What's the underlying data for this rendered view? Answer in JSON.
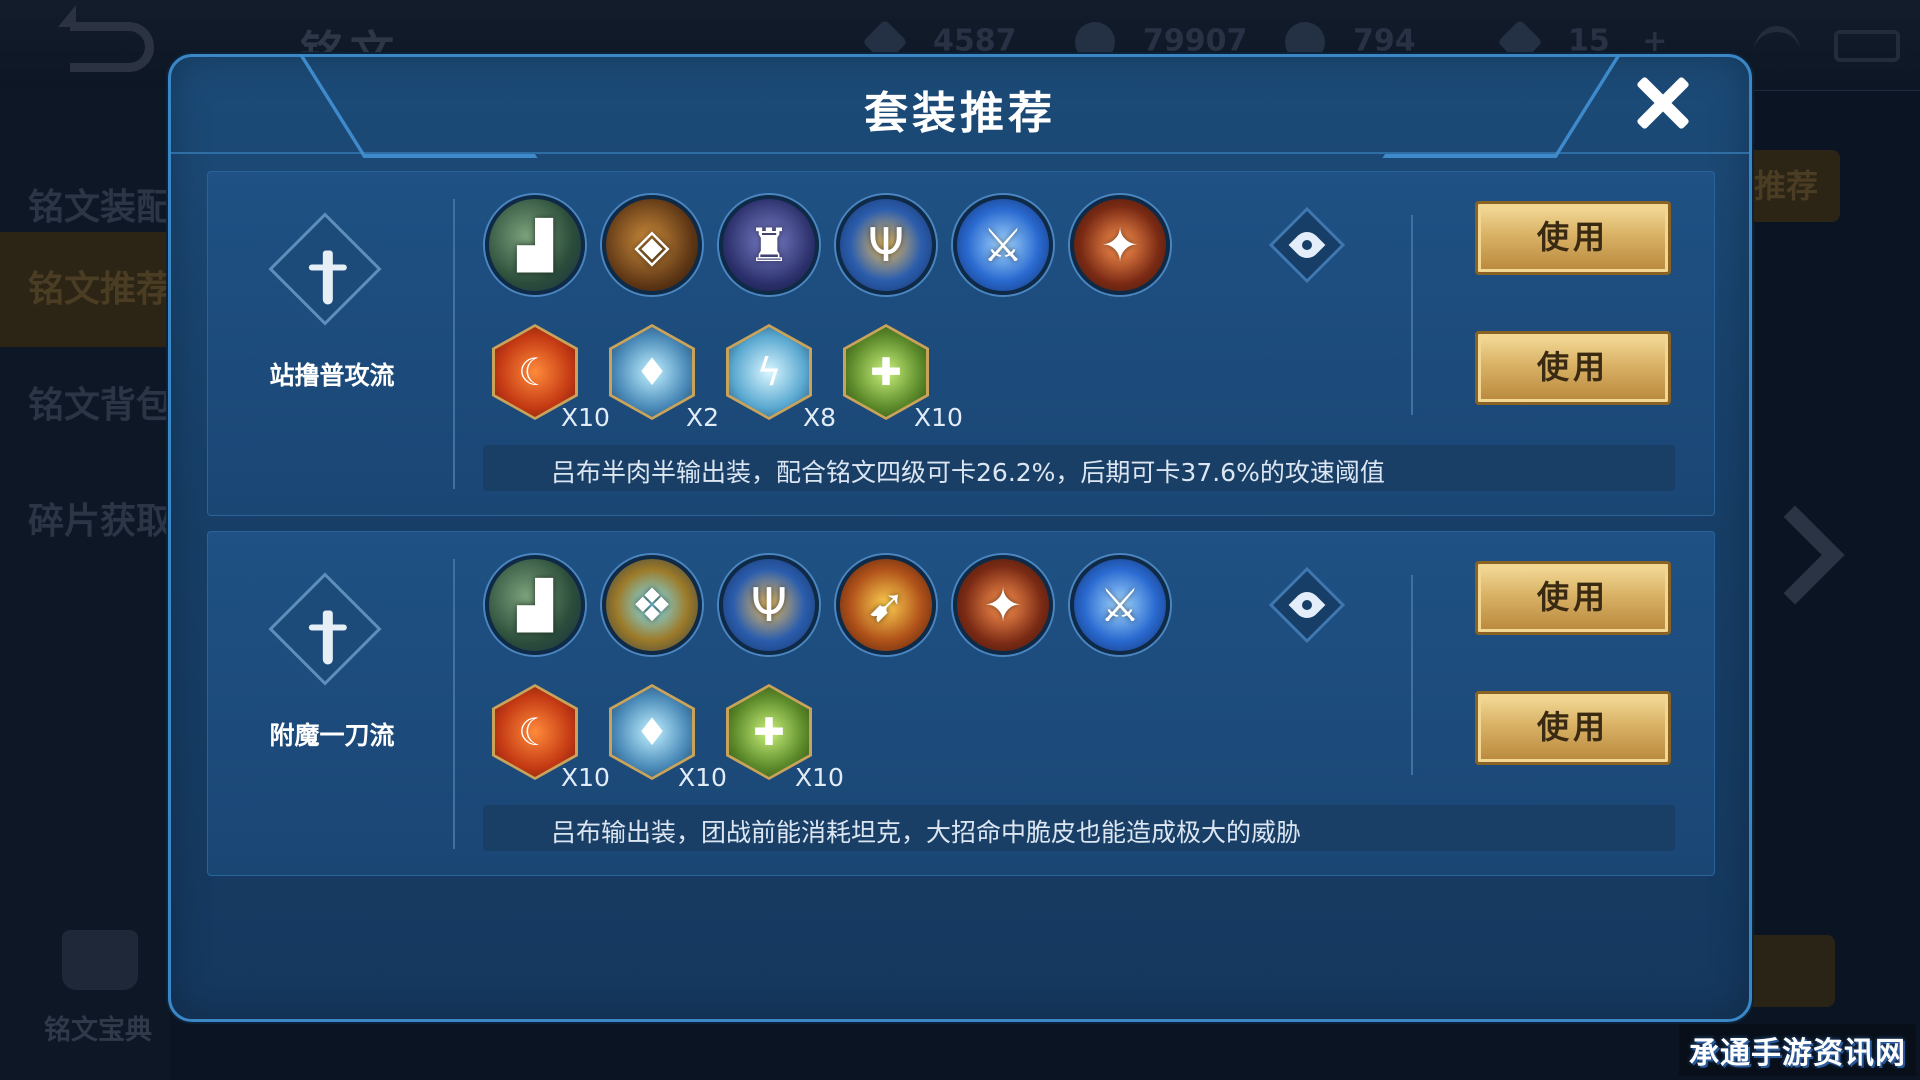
{
  "background": {
    "title": "铭文",
    "resources": [
      "4587",
      "79907",
      "794",
      "15"
    ],
    "plus_symbol": "+",
    "sidebar_items": [
      "铭文装配",
      "铭文推荐",
      "铭文背包",
      "碎片获取"
    ],
    "codex_label": "铭文宝典",
    "right_button_label": "推荐"
  },
  "modal": {
    "title": "套装推荐",
    "close_icon": "close-icon",
    "sets": [
      {
        "name": "站撸普攻流",
        "equipment": [
          "boots",
          "armor",
          "cloak",
          "trident",
          "blade",
          "axe"
        ],
        "runes": [
          {
            "type": "red",
            "count": "X10"
          },
          {
            "type": "blue",
            "count": "X2"
          },
          {
            "type": "bolt",
            "count": "X8"
          },
          {
            "type": "green",
            "count": "X10"
          }
        ],
        "use_label_1": "使用",
        "use_label_2": "使用",
        "description": "吕布半肉半输出装，配合铭文四级可卡26.2%，后期可卡37.6%的攻速阈值"
      },
      {
        "name": "附魔一刀流",
        "equipment": [
          "boots",
          "mask",
          "trident",
          "bow",
          "axe",
          "blade"
        ],
        "runes": [
          {
            "type": "red",
            "count": "X10"
          },
          {
            "type": "blue",
            "count": "X10"
          },
          {
            "type": "green",
            "count": "X10"
          }
        ],
        "use_label_1": "使用",
        "use_label_2": "使用",
        "description": "吕布输出装，团战前能消耗坦克，大招命中脆皮也能造成极大的威胁"
      }
    ]
  },
  "watermark": "承通手游资讯网",
  "colors": {
    "modal_bg": "#1c4b78",
    "card_bg": "#1f5184",
    "button_gold": "#d9b266",
    "accent_border": "#3b86c4"
  }
}
